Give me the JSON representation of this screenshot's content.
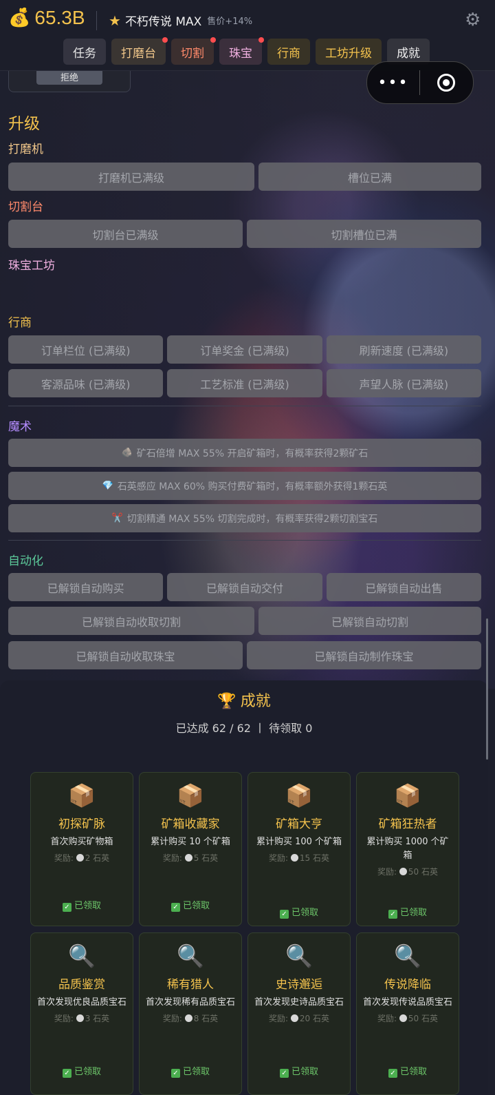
{
  "header": {
    "money_icon": "money-bag-icon",
    "money": "65.3B",
    "rank_icon": "star-icon",
    "rank_name": "不朽传说 MAX",
    "rank_bonus": "售价+14%",
    "settings_icon": "gear-icon"
  },
  "tabs": [
    {
      "label": "任务",
      "dot": false
    },
    {
      "label": "打磨台",
      "dot": true
    },
    {
      "label": "切割",
      "dot": true
    },
    {
      "label": "珠宝",
      "dot": true
    },
    {
      "label": "行商",
      "dot": false
    },
    {
      "label": "工坊升级",
      "dot": false
    },
    {
      "label": "成就",
      "dot": false
    }
  ],
  "capsule": {
    "more_icon": "more-dots-icon",
    "close_icon": "target-close-icon"
  },
  "prev_card": {
    "reject_label": "拒绝"
  },
  "upgrade": {
    "heading": "升级",
    "grinder": {
      "label": "打磨机",
      "buttons": [
        "打磨机已满级",
        "槽位已满"
      ]
    },
    "cutter": {
      "label": "切割台",
      "buttons": [
        "切割台已满级",
        "切割槽位已满"
      ]
    },
    "jewelry": {
      "label": "珠宝工坊"
    },
    "merchant": {
      "label": "行商",
      "buttons": [
        "订单栏位 (已满级)",
        "订单奖金 (已满级)",
        "刷新速度 (已满级)",
        "客源品味 (已满级)",
        "工艺标准 (已满级)",
        "声望人脉 (已满级)"
      ]
    }
  },
  "magic": {
    "label": "魔术",
    "items": [
      {
        "icon": "ore-icon",
        "glyph": "🪨",
        "text": "矿石倍增 MAX 55% 开启矿箱时，有概率获得2颗矿石"
      },
      {
        "icon": "diamond-icon",
        "glyph": "💎",
        "text": "石英感应 MAX 60% 购买付费矿箱时，有概率额外获得1颗石英"
      },
      {
        "icon": "scissors-icon",
        "glyph": "✂️",
        "text": "切割精通 MAX 55% 切割完成时，有概率获得2颗切割宝石"
      }
    ]
  },
  "automation": {
    "label": "自动化",
    "row1": [
      "已解锁自动购买",
      "已解锁自动交付",
      "已解锁自动出售"
    ],
    "row2": [
      "已解锁自动收取切割",
      "已解锁自动切割"
    ],
    "row3": [
      "已解锁自动收取珠宝",
      "已解锁自动制作珠宝"
    ]
  },
  "achievements": {
    "title_icon": "trophy-icon",
    "title": "成就",
    "stats": "已达成 62 / 62 丨 待领取 0",
    "reward_prefix": "奖励: ",
    "reward_suffix": " 石英",
    "claimed_label": "已领取",
    "cards": [
      {
        "icon": "box-icon",
        "glyph": "📦",
        "title": "初探矿脉",
        "desc": "首次购买矿物箱",
        "reward": "2"
      },
      {
        "icon": "box-icon",
        "glyph": "📦",
        "title": "矿箱收藏家",
        "desc": "累计购买 10 个矿箱",
        "reward": "5"
      },
      {
        "icon": "box-icon",
        "glyph": "📦",
        "title": "矿箱大亨",
        "desc": "累计购买 100 个矿箱",
        "reward": "15"
      },
      {
        "icon": "box-icon",
        "glyph": "📦",
        "title": "矿箱狂热者",
        "desc": "累计购买 1000 个矿箱",
        "reward": "50"
      },
      {
        "icon": "magnifier-icon",
        "glyph": "🔍",
        "title": "品质鉴赏",
        "desc": "首次发现优良品质宝石",
        "reward": "3"
      },
      {
        "icon": "magnifier-icon",
        "glyph": "🔍",
        "title": "稀有猎人",
        "desc": "首次发现稀有品质宝石",
        "reward": "8"
      },
      {
        "icon": "magnifier-icon",
        "glyph": "🔍",
        "title": "史诗邂逅",
        "desc": "首次发现史诗品质宝石",
        "reward": "20"
      },
      {
        "icon": "magnifier-icon",
        "glyph": "🔍",
        "title": "传说降临",
        "desc": "首次发现传说品质宝石",
        "reward": "50"
      }
    ]
  },
  "colors": {
    "accent_gold": "#f3c24d",
    "grinder": "#f0c68a",
    "cutter": "#ff8a6b",
    "jewelry": "#f0b0e0",
    "magic": "#b48cff",
    "automation": "#5cc99a",
    "claimed": "#6dc76a",
    "notify_dot": "#ff4d4f"
  }
}
